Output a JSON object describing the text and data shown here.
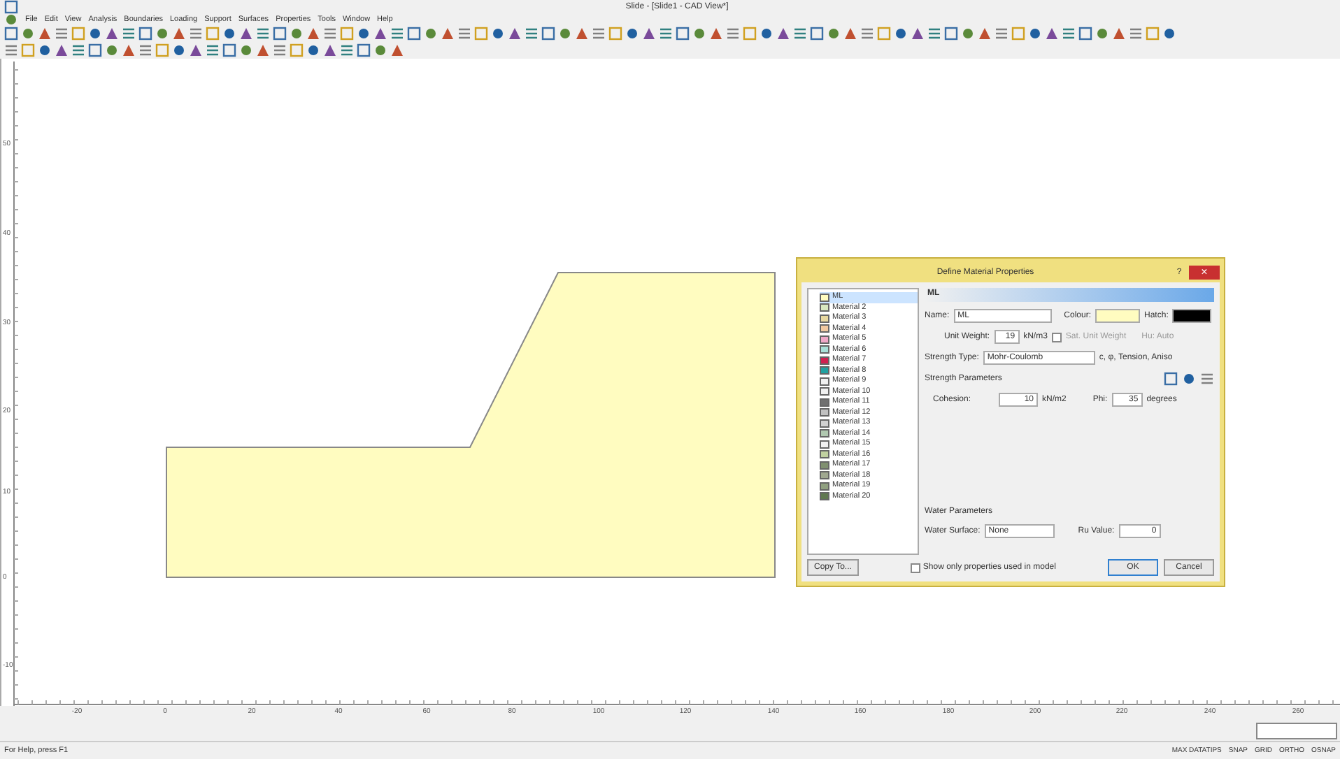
{
  "window": {
    "title": "Slide - [Slide1 - CAD View*]"
  },
  "menu": [
    "File",
    "Edit",
    "View",
    "Analysis",
    "Boundaries",
    "Loading",
    "Support",
    "Surfaces",
    "Properties",
    "Tools",
    "Window",
    "Help"
  ],
  "canvas": {
    "y_ticks": [
      "50",
      "40",
      "30",
      "20",
      "10",
      "0",
      "-10"
    ],
    "x_ticks": [
      "-20",
      "0",
      "20",
      "40",
      "60",
      "80",
      "100",
      "120",
      "140",
      "160",
      "180",
      "200",
      "220",
      "240",
      "260"
    ]
  },
  "dialog": {
    "title": "Define Material Properties",
    "help": "?",
    "close": "×",
    "materials": [
      {
        "name": "ML",
        "color": "#fffcc0",
        "selected": true
      },
      {
        "name": "Material 2",
        "color": "#d8e8c0",
        "selected": false
      },
      {
        "name": "Material 3",
        "color": "#e8d8a0",
        "selected": false
      },
      {
        "name": "Material 4",
        "color": "#f0c8a0",
        "selected": false
      },
      {
        "name": "Material 5",
        "color": "#f0a8c8",
        "selected": false
      },
      {
        "name": "Material 6",
        "color": "#a8e0d8",
        "selected": false
      },
      {
        "name": "Material 7",
        "color": "#d02050",
        "selected": false
      },
      {
        "name": "Material 8",
        "color": "#20a0a0",
        "selected": false
      },
      {
        "name": "Material 9",
        "color": "#f0f0f0",
        "selected": false
      },
      {
        "name": "Material 10",
        "color": "#f0f0f0",
        "selected": false
      },
      {
        "name": "Material 11",
        "color": "#707070",
        "selected": false
      },
      {
        "name": "Material 12",
        "color": "#c0c0c0",
        "selected": false
      },
      {
        "name": "Material 13",
        "color": "#d0d0d0",
        "selected": false
      },
      {
        "name": "Material 14",
        "color": "#b0c8b0",
        "selected": false
      },
      {
        "name": "Material 15",
        "color": "#f0f0f0",
        "selected": false
      },
      {
        "name": "Material 16",
        "color": "#c0d0a0",
        "selected": false
      },
      {
        "name": "Material 17",
        "color": "#809070",
        "selected": false
      },
      {
        "name": "Material 18",
        "color": "#a0a890",
        "selected": false
      },
      {
        "name": "Material 19",
        "color": "#90a080",
        "selected": false
      },
      {
        "name": "Material 20",
        "color": "#607850",
        "selected": false
      }
    ],
    "header": "ML",
    "name_label": "Name:",
    "name_value": "ML",
    "colour_label": "Colour:",
    "colour_picker": {
      "color": "#fffcc0"
    },
    "hatch_label": "Hatch:",
    "hatch_picker": {
      "color": "#000000"
    },
    "unit_weight_label": "Unit Weight:",
    "unit_weight": "19",
    "unit_weight_unit": "kN/m3",
    "sat_weight": {
      "label": "Sat. Unit Weight",
      "checked": false
    },
    "hu": "Hu: Auto",
    "strength_type_label": "Strength Type:",
    "strength_type": "Mohr-Coulomb",
    "strength_symbols": "c, φ, Tension, Aniso",
    "strength_group": "Strength Parameters",
    "cohesion_label": "Cohesion:",
    "cohesion": "10",
    "cohesion_unit": "kN/m2",
    "phi_label": "Phi:",
    "phi": "35",
    "phi_unit": "degrees",
    "water_group": "Water Parameters",
    "water_surface_label": "Water Surface:",
    "water_surface": "None",
    "ru_label": "Ru Value:",
    "ru": "0",
    "copy_button": "Copy To...",
    "show_only": {
      "label": "Show only properties used in model",
      "checked": false
    },
    "ok": "OK",
    "cancel": "Cancel"
  },
  "status_bar": {
    "help": "For Help, press F1",
    "indicators": [
      "MAX DATATIPS",
      "SNAP",
      "GRID",
      "ORTHO",
      "OSNAP"
    ]
  }
}
